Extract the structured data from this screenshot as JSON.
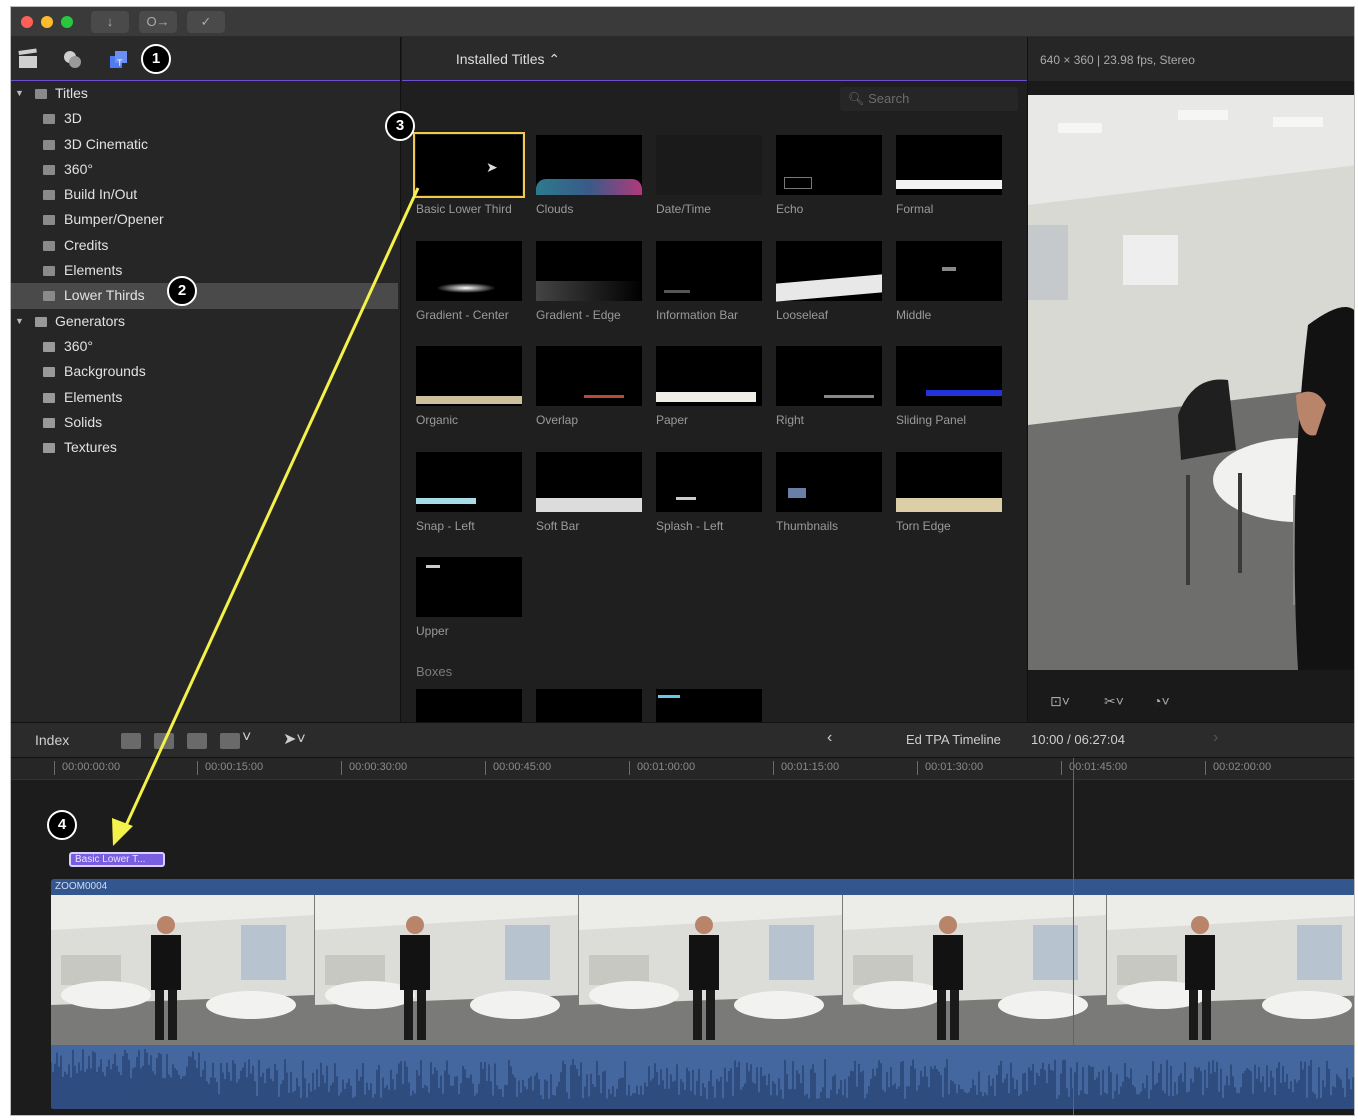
{
  "toolbar": {
    "download_icon": "↓",
    "key_icon": "O→",
    "check_icon": "✓"
  },
  "callouts": [
    "1",
    "2",
    "3",
    "4"
  ],
  "sidebar": {
    "items": [
      {
        "label": "Titles",
        "kind": "group"
      },
      {
        "label": "3D",
        "kind": "title"
      },
      {
        "label": "3D Cinematic",
        "kind": "title"
      },
      {
        "label": "360°",
        "kind": "title"
      },
      {
        "label": "Build In/Out",
        "kind": "title"
      },
      {
        "label": "Bumper/Opener",
        "kind": "title"
      },
      {
        "label": "Credits",
        "kind": "title"
      },
      {
        "label": "Elements",
        "kind": "title"
      },
      {
        "label": "Lower Thirds",
        "kind": "title",
        "selected": true
      },
      {
        "label": "Generators",
        "kind": "group"
      },
      {
        "label": "360°",
        "kind": "generator"
      },
      {
        "label": "Backgrounds",
        "kind": "generator"
      },
      {
        "label": "Elements",
        "kind": "generator"
      },
      {
        "label": "Solids",
        "kind": "generator"
      },
      {
        "label": "Textures",
        "kind": "generator"
      }
    ]
  },
  "browser": {
    "title": "Installed Titles ⌃",
    "search_placeholder": "Search",
    "tiles": [
      "Basic Lower Third",
      "Clouds",
      "Date/Time",
      "Echo",
      "Formal",
      "Gradient - Center",
      "Gradient - Edge",
      "Information Bar",
      "Looseleaf",
      "Middle",
      "Organic",
      "Overlap",
      "Paper",
      "Right",
      "Sliding Panel",
      "Snap - Left",
      "Soft Bar",
      "Splash - Left",
      "Thumbnails",
      "Torn Edge",
      "Upper"
    ],
    "section_label": "Boxes"
  },
  "viewer": {
    "info": "640 × 360 | 23.98 fps, Stereo"
  },
  "timeline": {
    "index_label": "Index",
    "name": "Ed TPA Timeline",
    "time": "10:00 / 06:27:04",
    "ruler": [
      "00:00:00:00",
      "00:00:15:00",
      "00:00:30:00",
      "00:00:45:00",
      "00:01:00:00",
      "00:01:15:00",
      "00:01:30:00",
      "00:01:45:00",
      "00:02:00:00"
    ],
    "title_clip": "Basic Lower T...",
    "video_clip": "ZOOM0004"
  },
  "colors": {
    "accent": "#6b4fd0",
    "selection": "#f2c94c",
    "arrow": "#f4f14a",
    "clip": "#34568e",
    "title_clip": "#7a5ee0"
  }
}
